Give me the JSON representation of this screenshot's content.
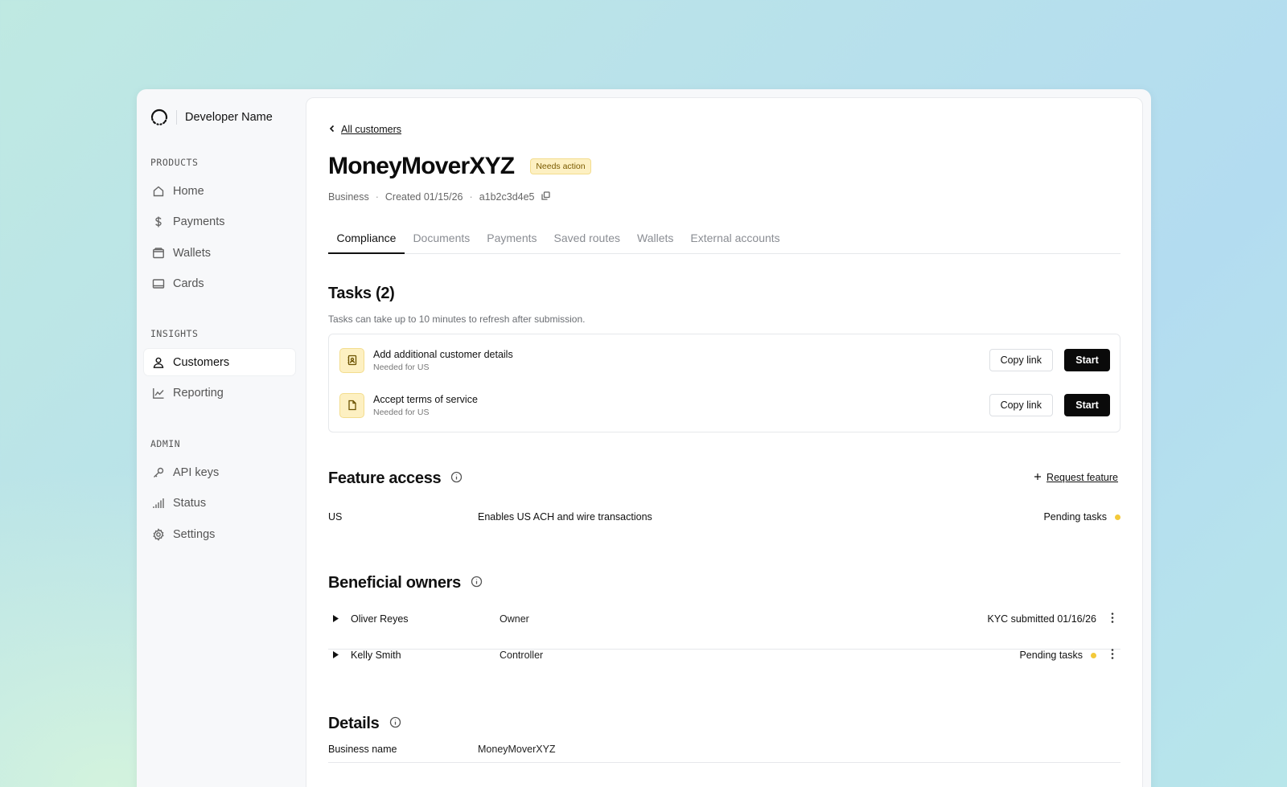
{
  "app": {
    "developer_name": "Developer Name"
  },
  "sidebar": {
    "sections": [
      {
        "heading": "PRODUCTS",
        "items": [
          {
            "label": "Home",
            "icon": "home-icon"
          },
          {
            "label": "Payments",
            "icon": "dollar-icon"
          },
          {
            "label": "Wallets",
            "icon": "wallet-icon"
          },
          {
            "label": "Cards",
            "icon": "card-icon"
          }
        ]
      },
      {
        "heading": "INSIGHTS",
        "items": [
          {
            "label": "Customers",
            "icon": "user-icon",
            "active": true
          },
          {
            "label": "Reporting",
            "icon": "chart-line-icon"
          }
        ]
      },
      {
        "heading": "ADMIN",
        "items": [
          {
            "label": "API keys",
            "icon": "key-icon"
          },
          {
            "label": "Status",
            "icon": "signal-bars-icon"
          },
          {
            "label": "Settings",
            "icon": "gear-icon"
          }
        ]
      }
    ]
  },
  "page": {
    "back_link": "All customers",
    "title": "MoneyMoverXYZ",
    "badge": "Needs action",
    "meta": {
      "type": "Business",
      "created": "Created 01/15/26",
      "id": "a1b2c3d4e5"
    },
    "tabs": [
      "Compliance",
      "Documents",
      "Payments",
      "Saved routes",
      "Wallets",
      "External accounts"
    ],
    "active_tab": "Compliance"
  },
  "tasks": {
    "title": "Tasks (2)",
    "subtitle": "Tasks can take up to 10 minutes to refresh after submission.",
    "items": [
      {
        "name": "Add additional customer details",
        "note": "Needed for US",
        "icon": "contact-card-icon",
        "copy_label": "Copy link",
        "start_label": "Start"
      },
      {
        "name": "Accept terms of service",
        "note": "Needed for US",
        "icon": "document-icon",
        "copy_label": "Copy link",
        "start_label": "Start"
      }
    ]
  },
  "feature_access": {
    "title": "Feature access",
    "request_label": "Request feature",
    "rows": [
      {
        "region": "US",
        "description": "Enables US ACH and wire transactions",
        "status": "Pending tasks"
      }
    ]
  },
  "beneficial_owners": {
    "title": "Beneficial owners",
    "rows": [
      {
        "name": "Oliver Reyes",
        "role": "Owner",
        "status": "KYC submitted 01/16/26",
        "pending": false
      },
      {
        "name": "Kelly Smith",
        "role": "Controller",
        "status": "Pending tasks",
        "pending": true
      }
    ]
  },
  "details": {
    "title": "Details",
    "rows": [
      {
        "key": "Business name",
        "value": "MoneyMoverXYZ"
      }
    ]
  },
  "colors": {
    "accent_dark": "#0a0a0a",
    "warning_bg": "#fdf0c2",
    "pending_dot": "#f3c93a"
  }
}
